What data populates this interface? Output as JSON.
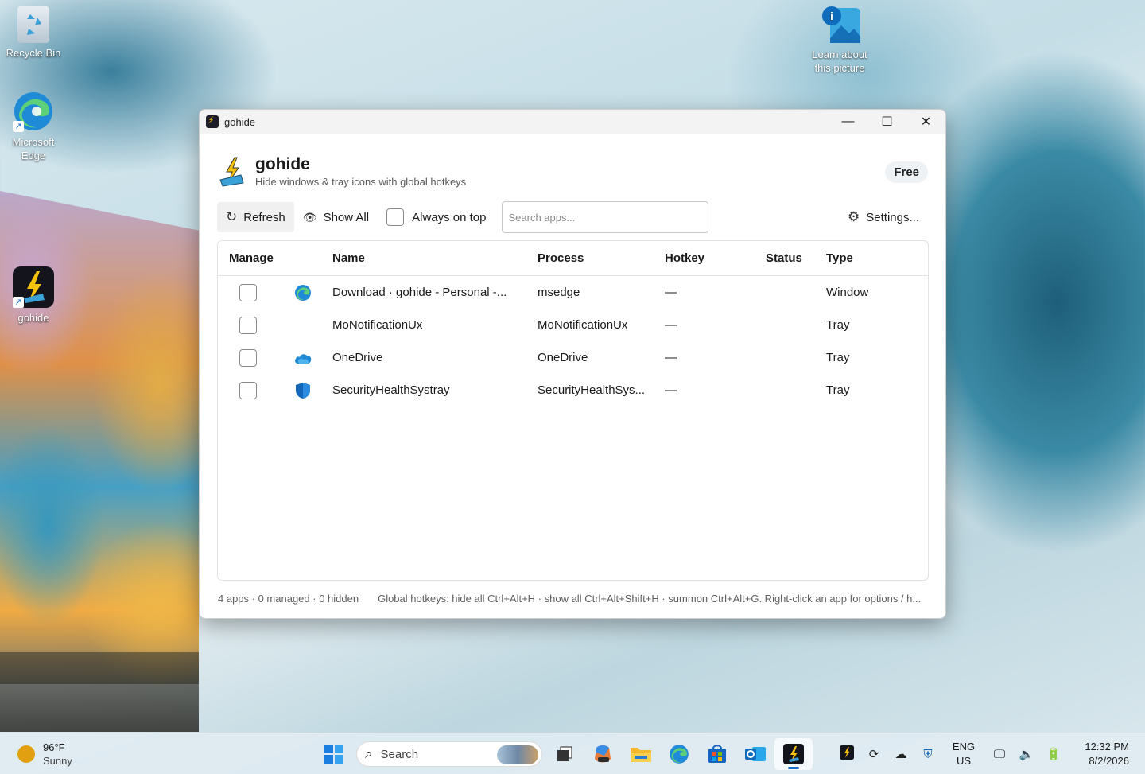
{
  "desktop": {
    "icons": [
      {
        "label": "Recycle Bin"
      },
      {
        "label": "Microsoft Edge"
      },
      {
        "label": "gohide"
      },
      {
        "label": "Learn about this picture"
      }
    ]
  },
  "window": {
    "title": "gohide",
    "controls": {
      "minimize": "—",
      "maximize": "☐",
      "close": "✕"
    }
  },
  "header": {
    "app_name": "gohide",
    "subtitle": "Hide windows & tray icons with global hotkeys",
    "badge": "Free"
  },
  "toolbar": {
    "refresh_label": "Refresh",
    "show_all_label": "Show All",
    "always_on_top_label": "Always on top",
    "always_on_top_checked": false,
    "search_placeholder": "Search apps...",
    "search_value": "",
    "settings_label": "Settings..."
  },
  "table": {
    "columns": [
      "Manage",
      "Name",
      "Process",
      "Hotkey",
      "Status",
      "Type"
    ],
    "rows": [
      {
        "managed": false,
        "icon": "edge-icon",
        "name": "Download · gohide - Personal -...",
        "process": "msedge",
        "hotkey": "—",
        "status": "",
        "type": "Window"
      },
      {
        "managed": false,
        "icon": "",
        "name": "MoNotificationUx",
        "process": "MoNotificationUx",
        "hotkey": "—",
        "status": "",
        "type": "Tray"
      },
      {
        "managed": false,
        "icon": "onedrive-icon",
        "name": "OneDrive",
        "process": "OneDrive",
        "hotkey": "—",
        "status": "",
        "type": "Tray"
      },
      {
        "managed": false,
        "icon": "security-shield-icon",
        "name": "SecurityHealthSystray",
        "process": "SecurityHealthSys...",
        "hotkey": "—",
        "status": "",
        "type": "Tray"
      }
    ]
  },
  "statusbar": {
    "counts": "4 apps · 0 managed · 0 hidden",
    "hint": "Global hotkeys: hide all Ctrl+Alt+H · show all Ctrl+Alt+Shift+H · summon Ctrl+Alt+G. Right-click an app for options / h..."
  },
  "taskbar": {
    "weather_temp": "96°F",
    "weather_desc": "Sunny",
    "search_label": "Search",
    "lang_top": "ENG",
    "lang_bottom": "US",
    "time": "12:32 PM",
    "date": "8/2/2026"
  },
  "colors": {
    "accent": "#1a6ecc",
    "edge_blue": "#1f8ad6",
    "shield_blue": "#1466b8",
    "gohide_yellow": "#f6c20a"
  }
}
